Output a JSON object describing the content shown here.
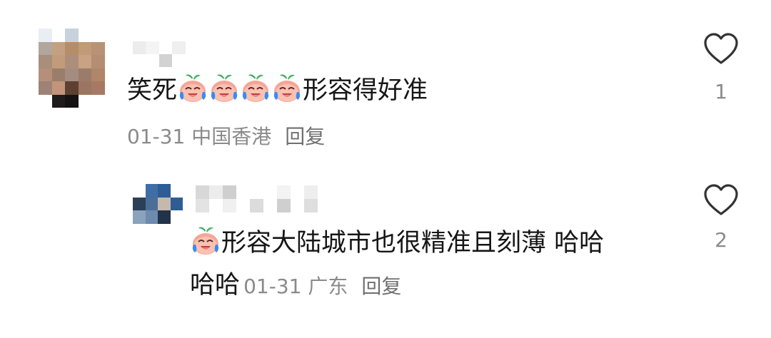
{
  "comments": [
    {
      "text_prefix": "笑死",
      "emoji_count": 4,
      "text_suffix": "形容得好准",
      "date": "01-31",
      "location": "中国香港",
      "reply_label": "回复",
      "like_count": "1",
      "emoji_icon": "crying-laughing-peach-emoji",
      "like_icon": "heart-outline-icon"
    },
    {
      "emoji_count": 1,
      "text_line1": "形容大陆城市也很精准且刻薄 哈哈",
      "text_line2": "哈哈",
      "date": "01-31",
      "location": "广东",
      "reply_label": "回复",
      "like_count": "2",
      "emoji_icon": "crying-laughing-peach-emoji",
      "like_icon": "heart-outline-icon"
    }
  ]
}
